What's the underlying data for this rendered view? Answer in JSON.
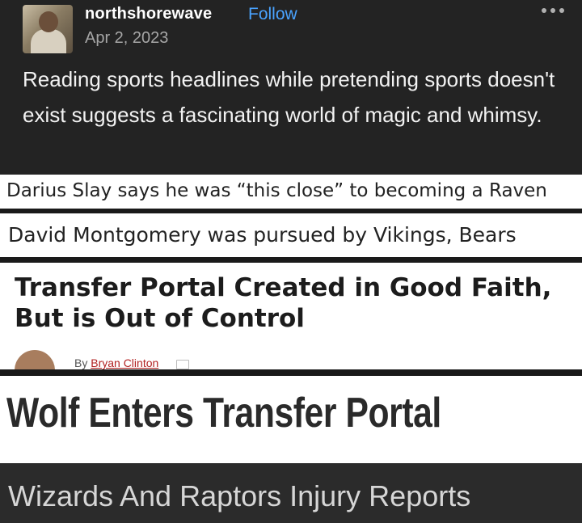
{
  "post": {
    "username": "northshorewave",
    "follow_label": "Follow",
    "date": "Apr 2, 2023",
    "text": "Reading sports headlines while pretending sports doesn't exist suggests a fascinating world of magic and whimsy."
  },
  "headlines": {
    "h1": "Darius Slay says he was “this close” to becoming a Raven",
    "h2": "David Montgomery was pursued by Vikings, Bears",
    "h3": "Transfer Portal Created in Good Faith, But is Out of Control",
    "h3_by": "By",
    "h3_author": "Bryan Clinton",
    "h4": "Wolf Enters Transfer Portal",
    "h5": "Wizards And Raptors Injury Reports"
  },
  "colors": {
    "follow": "#4aa3ff",
    "author_link": "#b22222"
  }
}
